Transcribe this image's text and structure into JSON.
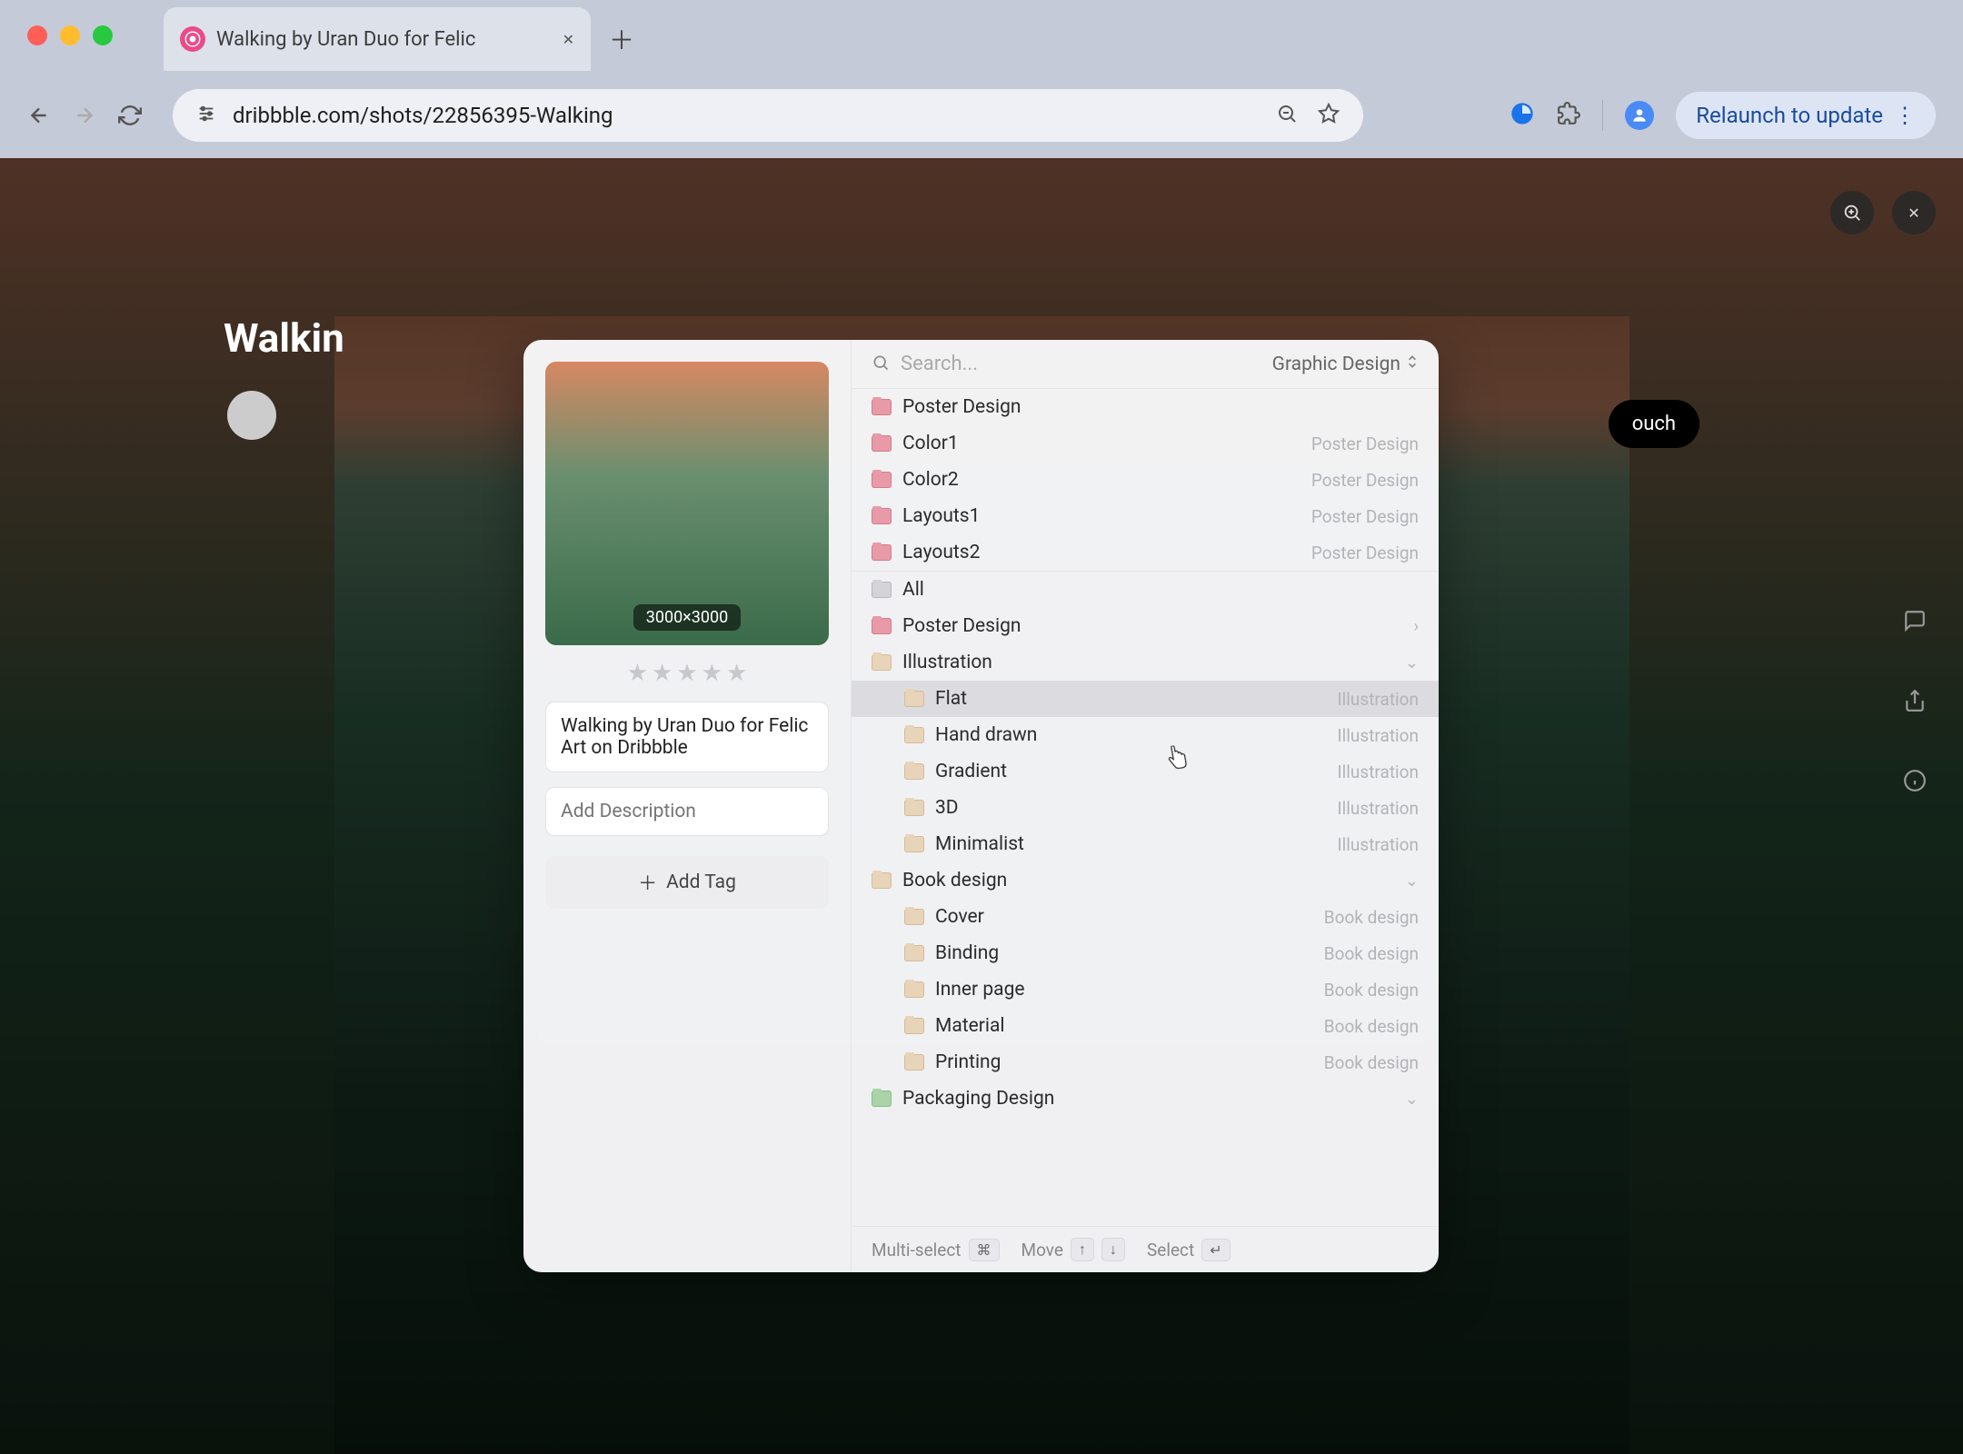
{
  "browser": {
    "tab_title": "Walking by Uran Duo for Felic",
    "url": "dribbble.com/shots/22856395-Walking",
    "relaunch_label": "Relaunch to update"
  },
  "page": {
    "title_behind": "Walkin",
    "get_in_touch": "ouch"
  },
  "modal": {
    "preview_dimensions": "3000×3000",
    "title_value": "Walking by Uran Duo for Felic Art on Dribbble",
    "description_placeholder": "Add Description",
    "add_tag_label": "Add Tag",
    "search_placeholder": "Search...",
    "category": "Graphic Design",
    "recent_folders": [
      {
        "label": "Poster Design",
        "sub": "",
        "icon": "fi-pink"
      },
      {
        "label": "Color1",
        "sub": "Poster Design",
        "icon": "fi-pink"
      },
      {
        "label": "Color2",
        "sub": "Poster Design",
        "icon": "fi-pink"
      },
      {
        "label": "Layouts1",
        "sub": "Poster Design",
        "icon": "fi-pink"
      },
      {
        "label": "Layouts2",
        "sub": "Poster Design",
        "icon": "fi-pink"
      }
    ],
    "tree": [
      {
        "label": "All",
        "icon": "fi-gray",
        "indent": 0
      },
      {
        "label": "Poster Design",
        "icon": "fi-pink",
        "indent": 0,
        "chevron": "right"
      },
      {
        "label": "Illustration",
        "icon": "fi-tan",
        "indent": 0,
        "chevron": "down"
      },
      {
        "label": "Flat",
        "sub": "Illustration",
        "icon": "fi-tan",
        "indent": 1,
        "highlighted": true
      },
      {
        "label": "Hand drawn",
        "sub": "Illustration",
        "icon": "fi-tan",
        "indent": 1
      },
      {
        "label": "Gradient",
        "sub": "Illustration",
        "icon": "fi-tan",
        "indent": 1
      },
      {
        "label": "3D",
        "sub": "Illustration",
        "icon": "fi-tan",
        "indent": 1
      },
      {
        "label": "Minimalist",
        "sub": "Illustration",
        "icon": "fi-tan",
        "indent": 1
      },
      {
        "label": "Book design",
        "icon": "fi-tan",
        "indent": 0,
        "chevron": "down"
      },
      {
        "label": "Cover",
        "sub": "Book design",
        "icon": "fi-tan",
        "indent": 1
      },
      {
        "label": "Binding",
        "sub": "Book design",
        "icon": "fi-tan",
        "indent": 1
      },
      {
        "label": "Inner page",
        "sub": "Book design",
        "icon": "fi-tan",
        "indent": 1
      },
      {
        "label": "Material",
        "sub": "Book design",
        "icon": "fi-tan",
        "indent": 1
      },
      {
        "label": "Printing",
        "sub": "Book design",
        "icon": "fi-tan",
        "indent": 1
      },
      {
        "label": "Packaging Design",
        "icon": "fi-green",
        "indent": 0,
        "chevron": "down"
      }
    ],
    "footer": {
      "multi_select": "Multi-select",
      "multi_select_key": "⌘",
      "move": "Move",
      "move_key_up": "↑",
      "move_key_down": "↓",
      "select": "Select",
      "select_key": "↵"
    }
  }
}
